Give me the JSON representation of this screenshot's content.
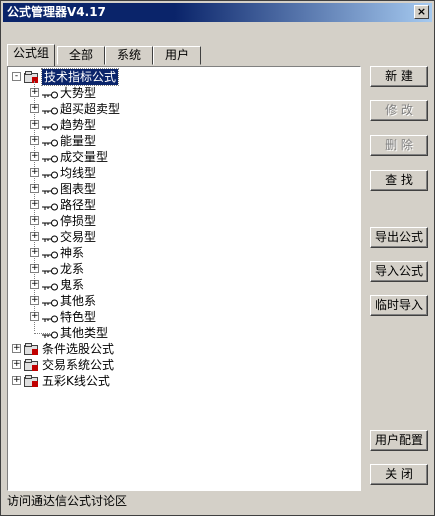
{
  "window": {
    "title": "公式管理器V4.17",
    "close_label": "×"
  },
  "tabs": [
    {
      "label": "公式组",
      "active": true
    },
    {
      "label": "全部",
      "active": false
    },
    {
      "label": "系统",
      "active": false
    },
    {
      "label": "用户",
      "active": false
    }
  ],
  "tree": {
    "root": {
      "label": "技术指标公式",
      "expanded": true,
      "selected": true
    },
    "children": [
      "大势型",
      "超买超卖型",
      "趋势型",
      "能量型",
      "成交量型",
      "均线型",
      "图表型",
      "路径型",
      "停损型",
      "交易型",
      "神系",
      "龙系",
      "鬼系",
      "其他系",
      "特色型",
      "其他类型"
    ],
    "other_roots": [
      "条件选股公式",
      "交易系统公式",
      "五彩K线公式"
    ]
  },
  "buttons": {
    "new": "新 建",
    "modify": "修 改",
    "delete": "删 除",
    "find": "查 找",
    "export": "导出公式",
    "import": "导入公式",
    "temp_import": "临时导入",
    "user_config": "用户配置",
    "close": "关 闭"
  },
  "status": {
    "text": "访问通达信公式讨论区"
  },
  "colors": {
    "title_bar": "#0a246a",
    "folder_red": "#c00000",
    "face": "#d4d0c8"
  }
}
